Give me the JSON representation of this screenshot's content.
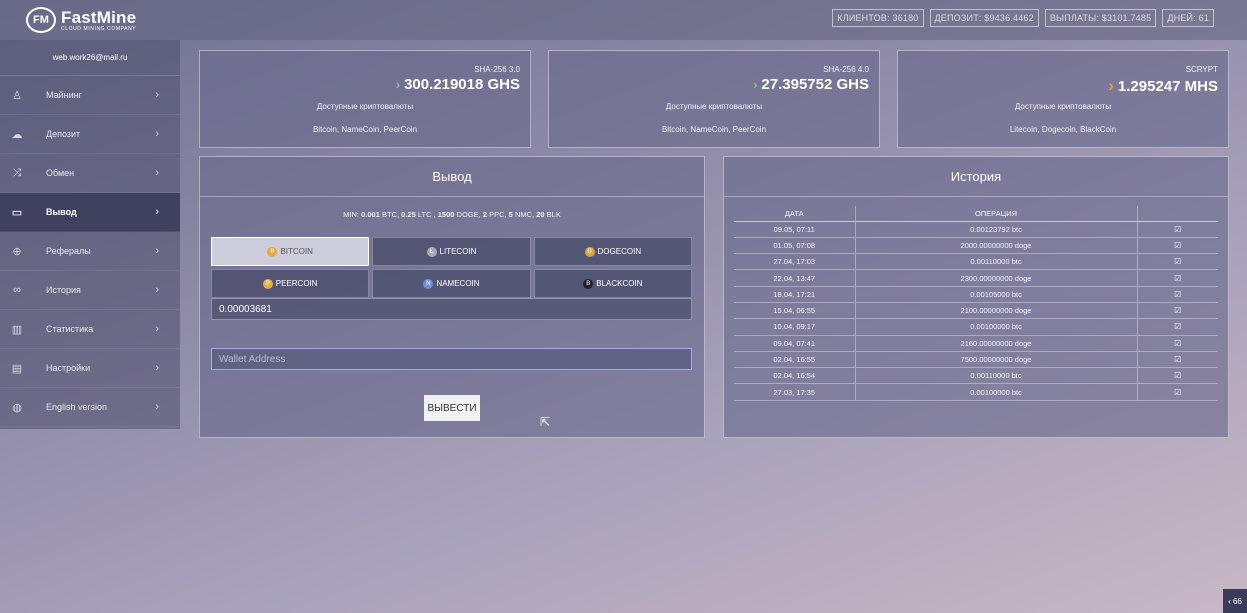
{
  "brand": {
    "mark": "FM",
    "name": "FastMine",
    "tagline": "CLOUD MINING COMPANY"
  },
  "stats": [
    "КЛИЕНТОВ: 36180",
    "ДЕПОЗИТ: $9436.4462",
    "ВЫПЛАТЫ: $3101.7485",
    "ДНЕЙ: 61"
  ],
  "sidebar": {
    "email": "web.work26@mail.ru",
    "items": [
      {
        "label": "Майнинг",
        "icon": "pickaxe-icon",
        "glyph": "♙"
      },
      {
        "label": "Депозит",
        "icon": "cloud-upload-icon",
        "glyph": "☁"
      },
      {
        "label": "Обмен",
        "icon": "shuffle-icon",
        "glyph": "⤨"
      },
      {
        "label": "Вывод",
        "icon": "wallet-icon",
        "glyph": "▭"
      },
      {
        "label": "Рефералы",
        "icon": "support-icon",
        "glyph": "⊕"
      },
      {
        "label": "История",
        "icon": "link-icon",
        "glyph": "∞"
      },
      {
        "label": "Статистика",
        "icon": "bar-chart-icon",
        "glyph": "▥"
      },
      {
        "label": "Настройки",
        "icon": "settings-panel-icon",
        "glyph": "▤"
      },
      {
        "label": "English version",
        "icon": "globe-icon",
        "glyph": "◍"
      }
    ],
    "chevron": "›"
  },
  "cards": [
    {
      "algo": "SHA-256 3.0",
      "speed": "300.219018 GHS",
      "label": "Доступные криптовалюты",
      "coins": "Bitcoin, NameCoin, PeerCoin",
      "arrow": "›"
    },
    {
      "algo": "SHA-256 4.0",
      "speed": "27.395752 GHS",
      "label": "Доступные криптовалюты",
      "coins": "Bitcoin, NameCoin, PeerCoin",
      "arrow": "›"
    },
    {
      "algo": "SCRYPT",
      "speed": "1.295247 MHS",
      "label": "Доступные криптовалюты",
      "coins": "Litecoin, Dogecoin, BlackCoin",
      "arrow": "›"
    }
  ],
  "withdraw": {
    "title": "Вывод",
    "min_prefix": "MIN:",
    "min_parts": [
      {
        "v": "0.001",
        "u": "BTC,"
      },
      {
        "v": "0.25",
        "u": "LTC ,"
      },
      {
        "v": "1500",
        "u": "DOGE,"
      },
      {
        "v": "2",
        "u": "PPC,"
      },
      {
        "v": "5",
        "u": "NMC,"
      },
      {
        "v": "20",
        "u": "BLK"
      }
    ],
    "coins": [
      {
        "label": "BITCOIN",
        "color": "#e8a93a",
        "glyph": "B",
        "active": true
      },
      {
        "label": "LITECOIN",
        "color": "#a8a8b8",
        "glyph": "Ł",
        "active": false
      },
      {
        "label": "DOGECOIN",
        "color": "#d9a441",
        "glyph": "D",
        "active": false
      },
      {
        "label": "PEERCOIN",
        "color": "#e0b040",
        "glyph": "P",
        "active": false
      },
      {
        "label": "NAMECOIN",
        "color": "#6f8fd8",
        "glyph": "N",
        "active": false
      },
      {
        "label": "BLACKCOIN",
        "color": "#222222",
        "glyph": "B",
        "active": false
      }
    ],
    "amount": "0.00003681",
    "wallet_placeholder": "Wallet Address",
    "button": "ВЫВЕСТИ"
  },
  "history": {
    "title": "История",
    "columns": [
      "ДАТА",
      "ОПЕРАЦИЯ",
      ""
    ],
    "check": "☑",
    "rows": [
      [
        "09.05, 07:11",
        "0.00123792 btc"
      ],
      [
        "01.05, 07:08",
        "2000.00000000 doge"
      ],
      [
        "27.04, 17:03",
        "0.00110000 btc"
      ],
      [
        "22.04, 13:47",
        "2300.00000000 doge"
      ],
      [
        "18.04, 17:21",
        "0.00105000 btc"
      ],
      [
        "15.04, 06:55",
        "2100.00000000 doge"
      ],
      [
        "10.04, 09:17",
        "0.00100000 btc"
      ],
      [
        "09.04, 07:41",
        "2160.00000000 doge"
      ],
      [
        "02.04, 16:55",
        "7500.00000000 doge"
      ],
      [
        "02.04, 16:54",
        "0.00110000 btc"
      ],
      [
        "27.03, 17:35",
        "0.00100000 btc"
      ]
    ]
  },
  "corner_tab": "‹ 66"
}
